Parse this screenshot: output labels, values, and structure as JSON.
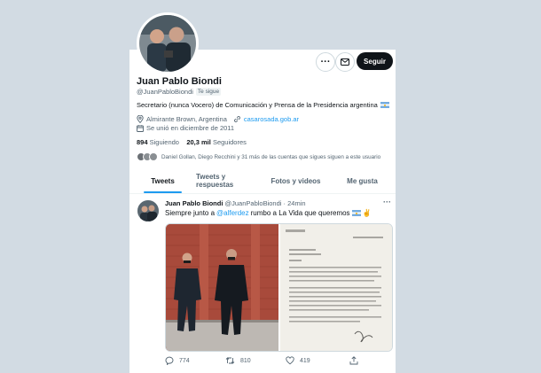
{
  "profile": {
    "name": "Juan Pablo Biondi",
    "handle": "@JuanPabloBiondi",
    "follows_you": "Te sigue",
    "bio": "Secretario (nunca Vocero) de Comunicación y Prensa de la Presidencia argentina",
    "location": "Almirante Brown, Argentina",
    "website": "casarosada.gob.ar",
    "joined": "Se unió en diciembre de 2011",
    "following_count": "894",
    "following_label": "Siguiendo",
    "followers_count": "20,3 mil",
    "followers_label": "Seguidores",
    "known_followers": "Daniel Gollan, Diego Recchini y 31 más de las cuentas que sigues siguen a este usuario"
  },
  "buttons": {
    "more": "···",
    "follow": "Seguir"
  },
  "tabs": [
    {
      "label": "Tweets",
      "active": true
    },
    {
      "label": "Tweets y respuestas",
      "active": false
    },
    {
      "label": "Fotos y videos",
      "active": false
    },
    {
      "label": "Me gusta",
      "active": false
    }
  ],
  "tweet": {
    "name": "Juan Pablo Biondi",
    "handle": "@JuanPabloBiondi",
    "separator": "·",
    "time": "24min",
    "text_before": "Siempre junto a",
    "mention": "@alferdez",
    "text_after": "rumbo a La Vida que queremos",
    "more": "···",
    "replies": "774",
    "retweets": "810",
    "likes": "419"
  },
  "colors": {
    "accent": "#1d9bf0",
    "text": "#0f1419",
    "muted": "#536471",
    "background": "#d2dbe3"
  },
  "icons": [
    "more-icon",
    "mail-icon",
    "location-icon",
    "link-icon",
    "calendar-icon",
    "reply-icon",
    "retweet-icon",
    "like-icon",
    "share-icon",
    "flag-icon",
    "victory-hand-icon"
  ]
}
